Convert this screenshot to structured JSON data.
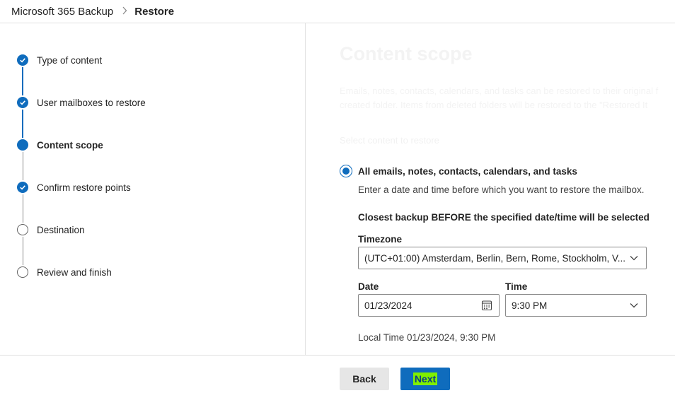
{
  "breadcrumb": {
    "root": "Microsoft 365 Backup",
    "separator": ">",
    "current": "Restore"
  },
  "steps": [
    {
      "label": "Type of content",
      "state": "completed"
    },
    {
      "label": "User mailboxes to restore",
      "state": "completed"
    },
    {
      "label": "Content scope",
      "state": "current"
    },
    {
      "label": "Confirm restore points",
      "state": "completed"
    },
    {
      "label": "Destination",
      "state": "pending"
    },
    {
      "label": "Review and finish",
      "state": "pending"
    }
  ],
  "content": {
    "title": "Content scope",
    "description_line1": "Emails, notes, contacts, calendars, and tasks can be restored to their original f",
    "description_line2": "created folder. Items from deleted folders will be restored to the \"Restored It",
    "section_label": "Select content to restore",
    "radio_option": {
      "label": "All emails, notes, contacts, calendars, and tasks",
      "selected": true,
      "help": "Enter a date and time before which you want to restore the mailbox."
    },
    "closest_backup_note": "Closest backup BEFORE the specified date/time will be selected",
    "timezone": {
      "label": "Timezone",
      "value": "(UTC+01:00) Amsterdam, Berlin, Bern, Rome, Stockholm, V..."
    },
    "date": {
      "label": "Date",
      "value": "01/23/2024"
    },
    "time": {
      "label": "Time",
      "value": "9:30 PM"
    },
    "local_time": "Local Time 01/23/2024, 9:30 PM"
  },
  "footer": {
    "back_label": "Back",
    "next_label": "Next",
    "next_highlight_color": "#7ff000"
  },
  "colors": {
    "accent": "#0f6cbd",
    "pending": "#616161"
  },
  "icons": {
    "breadcrumb_separator": "chevron-right-icon",
    "completed_step": "checkmark-circle-icon",
    "current_step": "filled-circle-icon",
    "pending_step": "empty-circle-icon",
    "date_picker": "calendar-icon",
    "dropdown": "chevron-down-icon"
  }
}
